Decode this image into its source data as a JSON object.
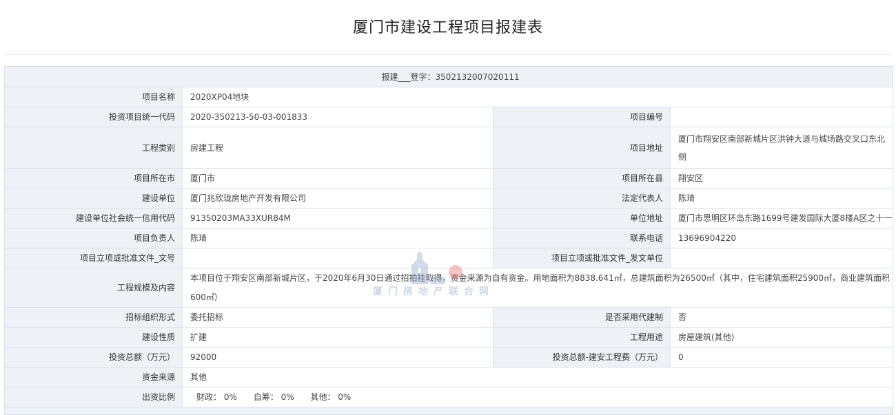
{
  "title": "厦门市建设工程项目报建表",
  "registration": "报建___登字：3502132007020111",
  "rows": {
    "project_name": {
      "label": "项目名称",
      "value": "2020XP04地块"
    },
    "invest_code": {
      "label": "投资项目统一代码",
      "value": "2020-350213-50-03-001833"
    },
    "project_no": {
      "label": "项目编号",
      "value": ""
    },
    "category": {
      "label": "工程类别",
      "value": "房建工程"
    },
    "address": {
      "label": "项目地址",
      "value": "厦门市翔安区南部新城片区洪钟大道与城场路交叉口东北侧"
    },
    "city": {
      "label": "项目所在市",
      "value": "厦门市"
    },
    "county": {
      "label": "项目所在县",
      "value": "翔安区"
    },
    "builder": {
      "label": "建设单位",
      "value": "厦门兆欣珑房地产开发有限公司"
    },
    "legal_rep": {
      "label": "法定代表人",
      "value": "陈琦"
    },
    "credit_code": {
      "label": "建设单位社会统一信用代码",
      "value": "91350203MA33XUR84M"
    },
    "unit_address": {
      "label": "单位地址",
      "value": "厦门市思明区环岛东路1699号建发国际大厦8楼A区之十一"
    },
    "manager": {
      "label": "项目负责人",
      "value": "陈琦"
    },
    "phone": {
      "label": "联系电话",
      "value": "13696904220"
    },
    "approval_doc": {
      "label": "项目立项或批准文件_文号",
      "value": ""
    },
    "approval_unit": {
      "label": "项目立项或批准文件_发文单位",
      "value": ""
    },
    "scale": {
      "label": "工程规模及内容",
      "value": "本项目位于翔安区南部新城片区，于2020年6月30日通过招拍挂取得，资金来源为自有资金。用地面积为8838.641㎡，总建筑面积为26500㎡（其中，住宅建筑面积25900㎡，商业建筑面积600㎡）"
    },
    "tender_form": {
      "label": "招标组织形式",
      "value": "委托招标"
    },
    "agent_build": {
      "label": "是否采用代建制",
      "value": "否"
    },
    "nature": {
      "label": "建设性质",
      "value": "扩建"
    },
    "usage": {
      "label": "工程用途",
      "value": "房屋建筑(其他)"
    },
    "total_invest": {
      "label": "投资总额（万元）",
      "value": "92000"
    },
    "install_cost": {
      "label": "投资总额-建安工程费（万元）",
      "value": "0"
    },
    "fund_source": {
      "label": "资金来源",
      "value": "其他"
    },
    "ratio": {
      "label": "出资比例",
      "fiscal_label": "财政：",
      "fiscal_value": "0%",
      "self_label": "自筹：",
      "self_value": "0%",
      "other_label": "其他：",
      "other_value": "0%"
    }
  },
  "watermark": {
    "text": "厦门房地产联合网",
    "icon": "house-logo-icon"
  }
}
